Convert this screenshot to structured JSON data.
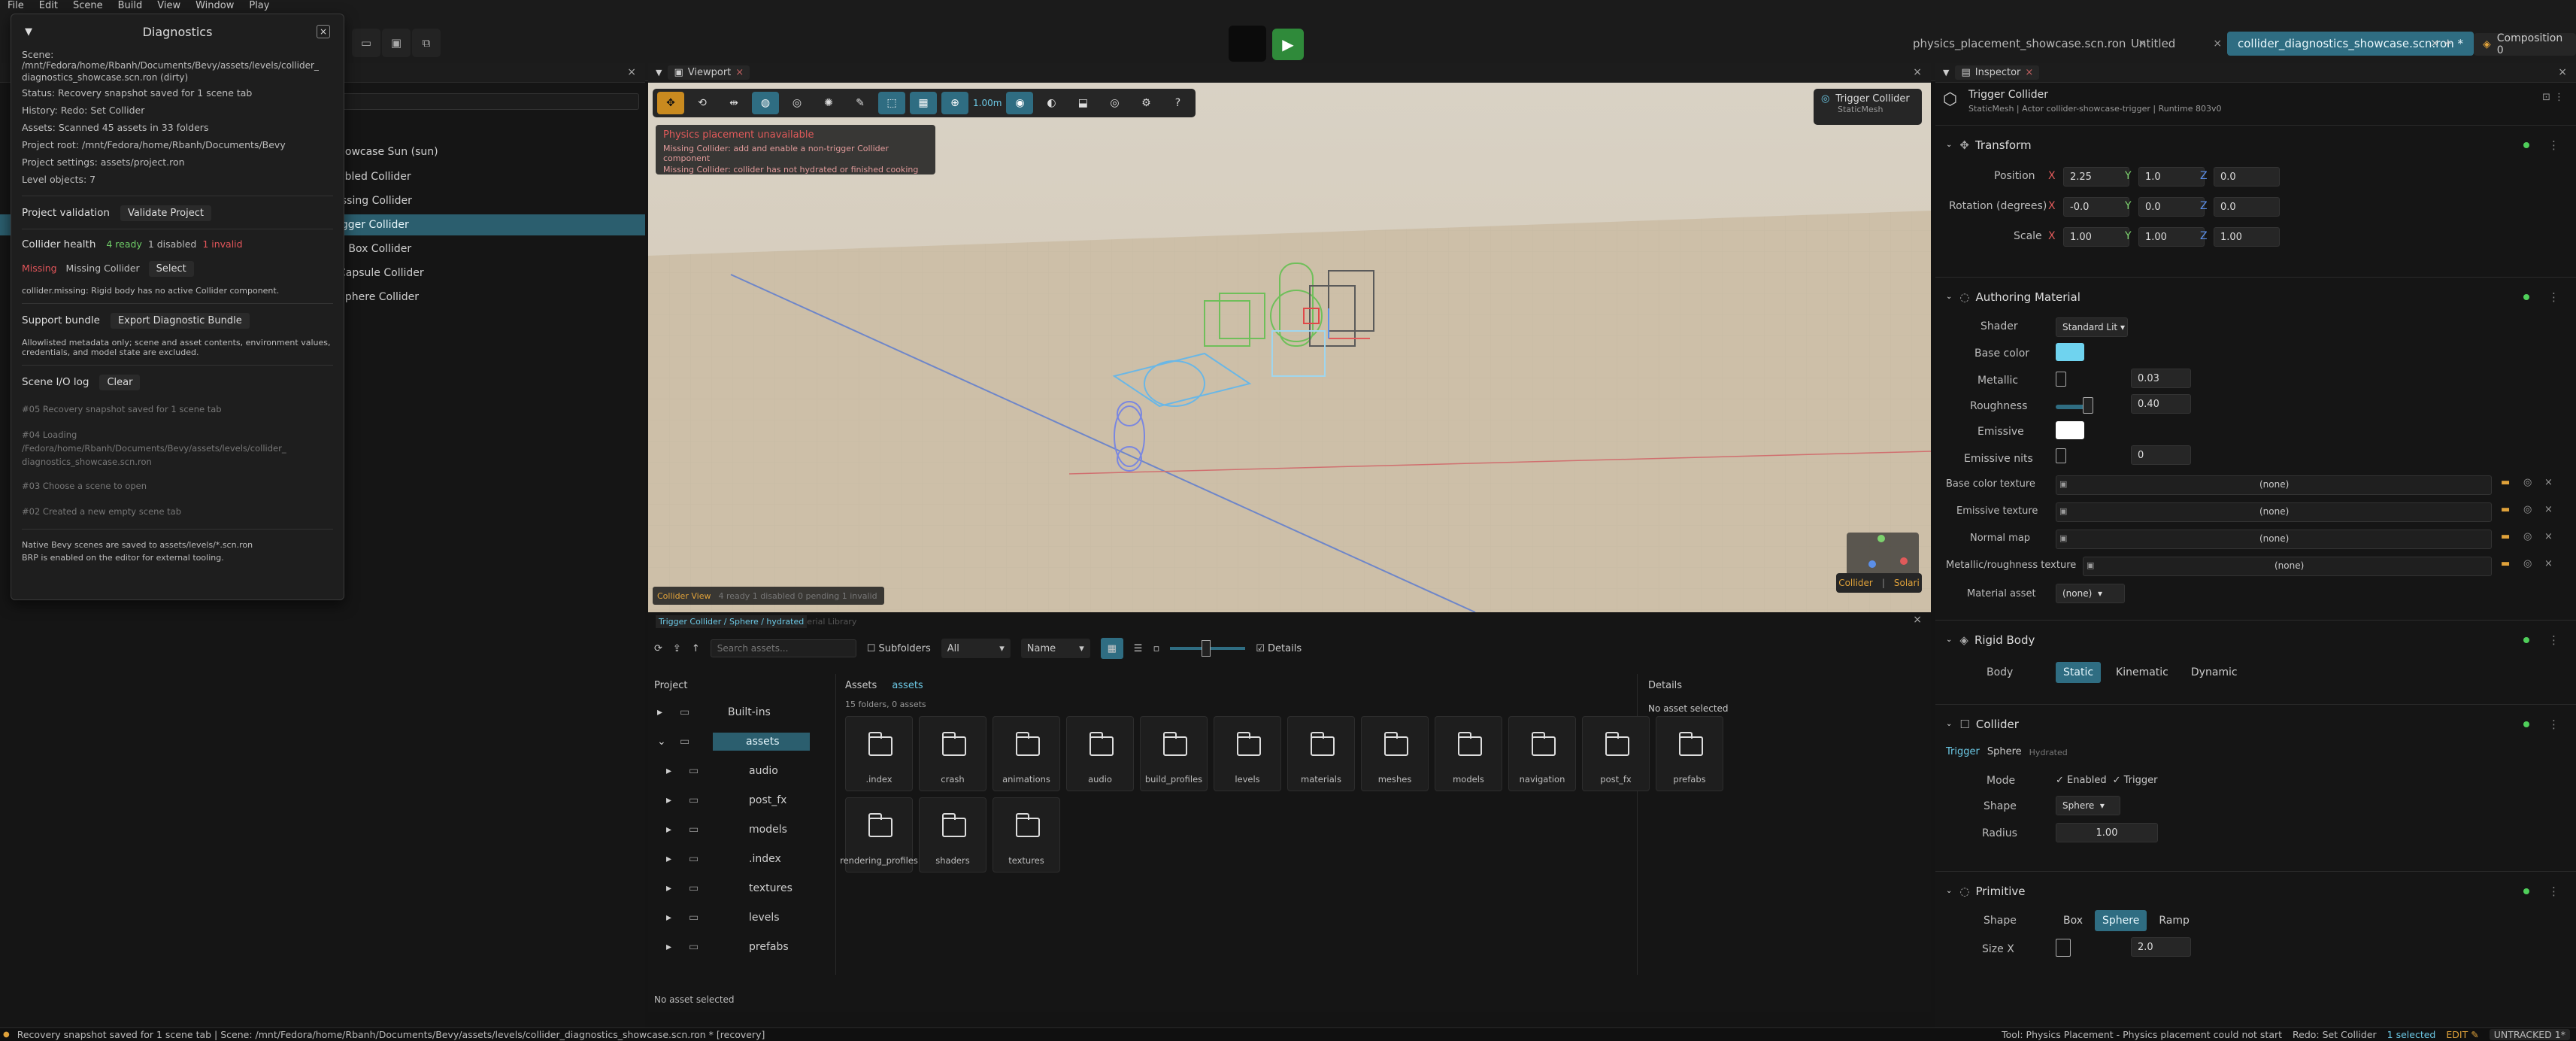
{
  "menu": [
    "File",
    "Edit",
    "Scene",
    "Build",
    "View",
    "Window",
    "Play"
  ],
  "scene_tabs": [
    {
      "label": "physics_placement_showcase.scn.ron"
    },
    {
      "label": "Untitled"
    },
    {
      "label": "collider_diagnostics_showcase.scn.ron *"
    }
  ],
  "composition_label": "Composition 0",
  "diagnostics": {
    "title": "Diagnostics",
    "scene_line1": "Scene:",
    "scene_line2": "/mnt/Fedora/home/Rbanh/Documents/Bevy/assets/levels/collider_",
    "scene_line3": "diagnostics_showcase.scn.ron (dirty)",
    "status": "Status: Recovery snapshot saved for 1 scene tab",
    "history": "History: Redo: Set Collider",
    "assets": "Assets: Scanned 45 assets in 33 folders",
    "project_root": "Project root: /mnt/Fedora/home/Rbanh/Documents/Bevy",
    "project_settings": "Project settings: assets/project.ron",
    "level_objects": "Level objects: 7",
    "project_validation_label": "Project validation",
    "validate_button": "Validate Project",
    "collider_health_label": "Collider health",
    "ready": "4 ready",
    "disabled": "1 disabled",
    "invalid": "1 invalid",
    "missing_tag": "Missing",
    "missing_name": "Missing Collider",
    "select_button": "Select",
    "missing_detail": "collider.missing: Rigid body has no active Collider component.",
    "support_label": "Support bundle",
    "export_button": "Export Diagnostic Bundle",
    "support_note1": "Allowlisted metadata only; scene and asset contents, environment values,",
    "support_note2": "credentials, and model state are excluded.",
    "io_label": "Scene I/O log",
    "clear_button": "Clear",
    "log": [
      "#05  Recovery snapshot saved for 1 scene tab",
      "#04  Loading",
      "/Fedora/home/Rbanh/Documents/Bevy/assets/levels/collider_",
      "diagnostics_showcase.scn.ron",
      "#03  Choose a scene to open",
      "#02  Created a new empty scene tab"
    ],
    "footer1": "Native Bevy scenes are saved to assets/levels/*.scn.ron",
    "footer2": "BRP is enabled on the editor for external tooling."
  },
  "outliner": {
    "rows": [
      "howcase Sun (sun)",
      "abled Collider",
      "issing Collider",
      "igger Collider",
      "d Box Collider",
      "Capsule Collider",
      "Sphere Collider"
    ],
    "selected_index": 3
  },
  "viewport": {
    "tab": "Viewport",
    "snap_value": "1.00m",
    "selection_badge_title": "Trigger Collider",
    "selection_badge_sub": "StaticMesh",
    "warning_title": "Physics placement unavailable",
    "warning_line1": "Missing Collider: add and enable a non-trigger Collider component",
    "warning_line2": "Missing Collider: collider has not hydrated or finished cooking",
    "collider_view_label": "Collider View",
    "collider_view_stats": "4 ready  1 disabled  0 pending  1 invalid",
    "breadcrumb": "Trigger Collider / Sphere / hydrated",
    "material_library_hint": "erial Library",
    "render_mode": "Collider",
    "render_mode2": "Solari"
  },
  "inspector": {
    "tab": "Inspector",
    "entity_name": "Trigger Collider",
    "entity_sub": "StaticMesh  |  Actor collider-showcase-trigger  |  Runtime 803v0",
    "transform": {
      "title": "Transform",
      "position_label": "Position",
      "position": [
        "2.25",
        "1.0",
        "0.0"
      ],
      "rotation_label": "Rotation (degrees)",
      "rotation": [
        "-0.0",
        "0.0",
        "0.0"
      ],
      "scale_label": "Scale",
      "scale": [
        "1.00",
        "1.00",
        "1.00"
      ],
      "x": "X",
      "y": "Y",
      "z": "Z"
    },
    "material": {
      "title": "Authoring Material",
      "shader_label": "Shader",
      "shader_value": "Standard Lit",
      "base_color_label": "Base color",
      "base_color": "#6fd3ef",
      "metallic_label": "Metallic",
      "metallic": "0.03",
      "roughness_label": "Roughness",
      "roughness": "0.40",
      "emissive_label": "Emissive",
      "emissive_color": "#ffffff",
      "emissive_nits_label": "Emissive nits",
      "emissive_nits": "0",
      "base_color_tex_label": "Base color texture",
      "emissive_tex_label": "Emissive texture",
      "normal_map_label": "Normal map",
      "mr_tex_label": "Metallic/roughness texture",
      "none": "(none)",
      "material_asset_label": "Material asset",
      "material_asset_value": "(none)"
    },
    "rigid_body": {
      "title": "Rigid Body",
      "body_label": "Body",
      "options": [
        "Static",
        "Kinematic",
        "Dynamic"
      ],
      "selected": "Static"
    },
    "collider": {
      "title": "Collider",
      "tag_trigger": "Trigger",
      "tag_shape": "Sphere",
      "tag_state": "Hydrated",
      "mode_label": "Mode",
      "enabled_label": "Enabled",
      "trigger_label": "Trigger",
      "shape_label": "Shape",
      "shape_value": "Sphere",
      "radius_label": "Radius",
      "radius_value": "1.00"
    },
    "primitive": {
      "title": "Primitive",
      "shape_label": "Shape",
      "options": [
        "Box",
        "Sphere",
        "Ramp"
      ],
      "selected": "Sphere",
      "size_x_label": "Size X",
      "size_x_value": "2.0"
    }
  },
  "asset_browser": {
    "search_placeholder": "Search assets...",
    "subfolders_label": "Subfolders",
    "filter_value": "All",
    "sort_value": "Name",
    "details_toggle": "Details",
    "project_header": "Project",
    "tree": [
      "Built-ins",
      "assets",
      "audio",
      "post_fx",
      "models",
      ".index",
      "textures",
      "levels",
      "prefabs"
    ],
    "breadcrumb_root": "Assets",
    "breadcrumb_current": "assets",
    "summary": "15 folders, 0 assets",
    "folders": [
      ".index",
      "crash",
      "animations",
      "audio",
      "build_profiles",
      "levels",
      "materials",
      "meshes",
      "models",
      "navigation",
      "post_fx",
      "prefabs",
      "rendering_profiles",
      "shaders",
      "textures"
    ],
    "details_header": "Details",
    "details_empty": "No asset selected",
    "status": "No asset selected"
  },
  "statusbar": {
    "left": "Recovery snapshot saved for 1 scene tab  |  Scene: /mnt/Fedora/home/Rbanh/Documents/Bevy/assets/levels/collider_diagnostics_showcase.scn.ron * [recovery]",
    "tool": "Tool: Physics Placement - Physics placement could not start",
    "redo": "Redo: Set Collider",
    "selected": "1 selected",
    "edit": "EDIT",
    "untracked": "UNTRACKED 1*"
  }
}
